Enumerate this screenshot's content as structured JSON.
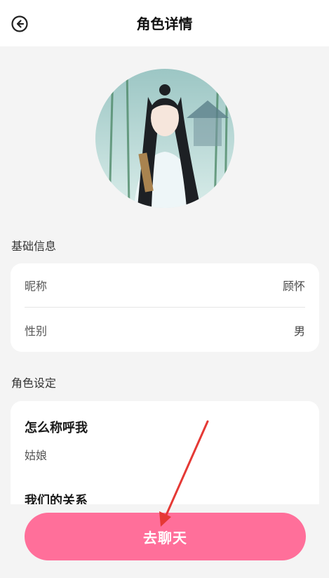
{
  "header": {
    "title": "角色详情"
  },
  "basic_info": {
    "section_title": "基础信息",
    "rows": [
      {
        "label": "昵称",
        "value": "顾怀"
      },
      {
        "label": "性别",
        "value": "男"
      }
    ]
  },
  "role_settings": {
    "section_title": "角色设定",
    "items": [
      {
        "question": "怎么称呼我",
        "answer": "姑娘"
      },
      {
        "question": "我们的关系",
        "answer": ""
      }
    ]
  },
  "actions": {
    "chat_label": "去聊天"
  },
  "colors": {
    "accent": "#ff6f9a",
    "annotation_arrow": "#e53935"
  },
  "icons": {
    "back": "back-arrow-circle-icon"
  }
}
